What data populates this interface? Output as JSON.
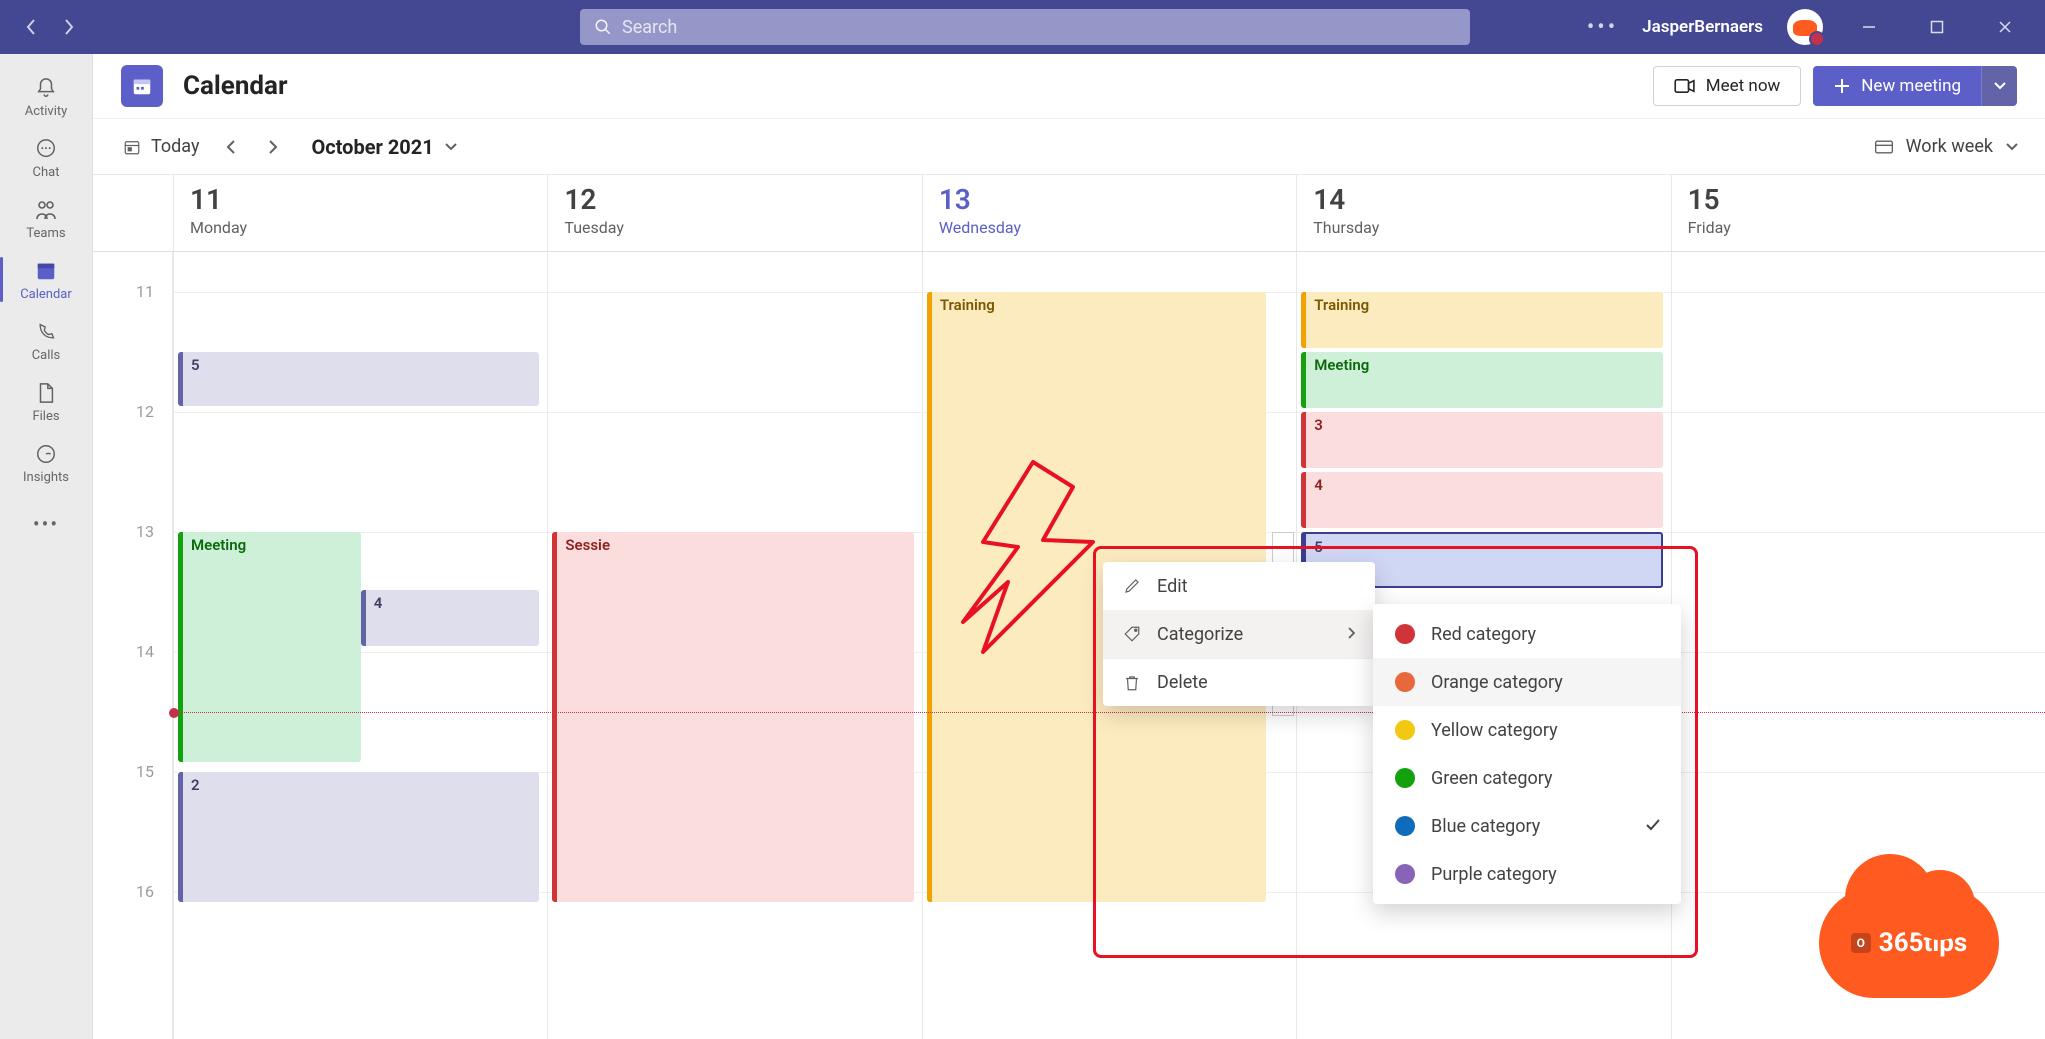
{
  "titlebar": {
    "search_placeholder": "Search",
    "username": "JasperBernaers"
  },
  "rail": {
    "items": [
      {
        "id": "activity",
        "label": "Activity"
      },
      {
        "id": "chat",
        "label": "Chat"
      },
      {
        "id": "teams",
        "label": "Teams"
      },
      {
        "id": "calendar",
        "label": "Calendar"
      },
      {
        "id": "calls",
        "label": "Calls"
      },
      {
        "id": "files",
        "label": "Files"
      },
      {
        "id": "insights",
        "label": "Insights"
      }
    ]
  },
  "header": {
    "title": "Calendar",
    "meet_now": "Meet now",
    "new_meeting": "New meeting"
  },
  "toolbar": {
    "today": "Today",
    "month": "October 2021",
    "view": "Work week"
  },
  "days": [
    {
      "num": "11",
      "name": "Monday",
      "today": false
    },
    {
      "num": "12",
      "name": "Tuesday",
      "today": false
    },
    {
      "num": "13",
      "name": "Wednesday",
      "today": true
    },
    {
      "num": "14",
      "name": "Thursday",
      "today": false
    },
    {
      "num": "15",
      "name": "Friday",
      "today": false
    }
  ],
  "hours": [
    "11",
    "12",
    "13",
    "14",
    "15",
    "16"
  ],
  "events": {
    "mon_5": "5",
    "mon_meeting": "Meeting",
    "mon_4": "4",
    "mon_2": "2",
    "tue_sessie": "Sessie",
    "wed_training": "Training",
    "thu_training": "Training",
    "thu_meeting": "Meeting",
    "thu_3": "3",
    "thu_4": "4",
    "thu_5": "5"
  },
  "context_menu": {
    "edit": "Edit",
    "categorize": "Categorize",
    "delete": "Delete"
  },
  "categories": [
    {
      "label": "Red category",
      "color": "#d13438"
    },
    {
      "label": "Orange category",
      "color": "#e8683c"
    },
    {
      "label": "Yellow category",
      "color": "#f2c811"
    },
    {
      "label": "Green category",
      "color": "#13a10e"
    },
    {
      "label": "Blue category",
      "color": "#0f6cbd",
      "checked": true
    },
    {
      "label": "Purple category",
      "color": "#8764b8"
    }
  ],
  "watermark": {
    "text": "365tips"
  }
}
